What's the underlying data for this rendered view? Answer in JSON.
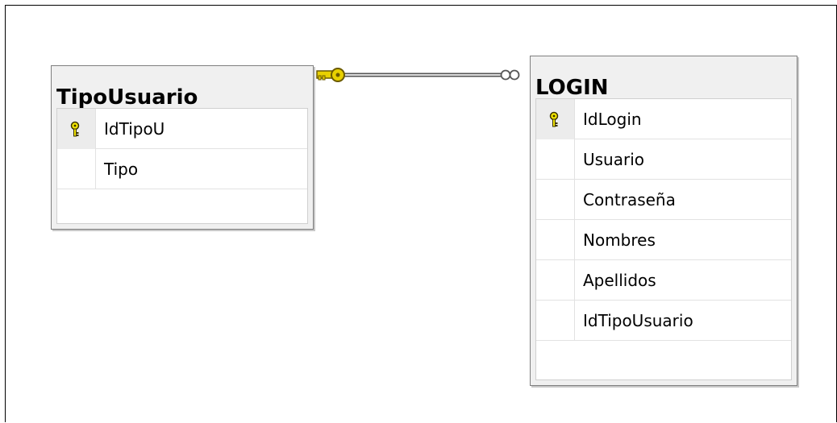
{
  "tables": [
    {
      "name": "TipoUsuario",
      "columns": [
        {
          "name": "IdTipoU",
          "primary_key": true
        },
        {
          "name": "Tipo",
          "primary_key": false
        }
      ]
    },
    {
      "name": "LOGIN",
      "columns": [
        {
          "name": "IdLogin",
          "primary_key": true
        },
        {
          "name": "Usuario",
          "primary_key": false
        },
        {
          "name": "Contraseña",
          "primary_key": false
        },
        {
          "name": "Nombres",
          "primary_key": false
        },
        {
          "name": "Apellidos",
          "primary_key": false
        },
        {
          "name": "IdTipoUsuario",
          "primary_key": false
        }
      ]
    }
  ],
  "relationship": {
    "from": "TipoUsuario",
    "to": "LOGIN",
    "from_end": "one",
    "to_end": "many",
    "from_icon": "key-icon",
    "to_icon": "infinity-icon",
    "key_color": "#e8d000"
  }
}
